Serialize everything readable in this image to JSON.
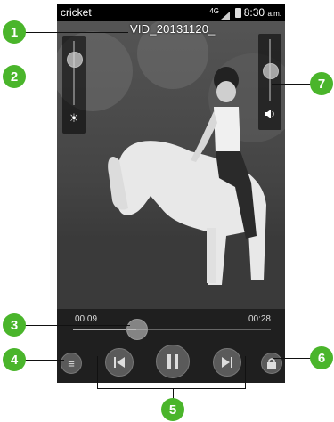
{
  "status": {
    "carrier": "cricket",
    "network": "4G",
    "time": "8:30",
    "ampm": "a.m."
  },
  "video": {
    "title": "VID_20131120_",
    "elapsed": "00:09",
    "total": "00:28",
    "progress": 0.32
  },
  "brightness": {
    "level": 0.72
  },
  "volume": {
    "level": 0.5
  },
  "icons": {
    "brightness": "brightness-icon",
    "volume": "volume-icon",
    "menu": "menu-icon",
    "previous": "previous-icon",
    "pause": "pause-icon",
    "next": "next-icon",
    "lock": "lock-icon"
  },
  "callouts": [
    "1",
    "2",
    "3",
    "4",
    "5",
    "6",
    "7"
  ],
  "colors": {
    "callout": "#4ab52b"
  }
}
